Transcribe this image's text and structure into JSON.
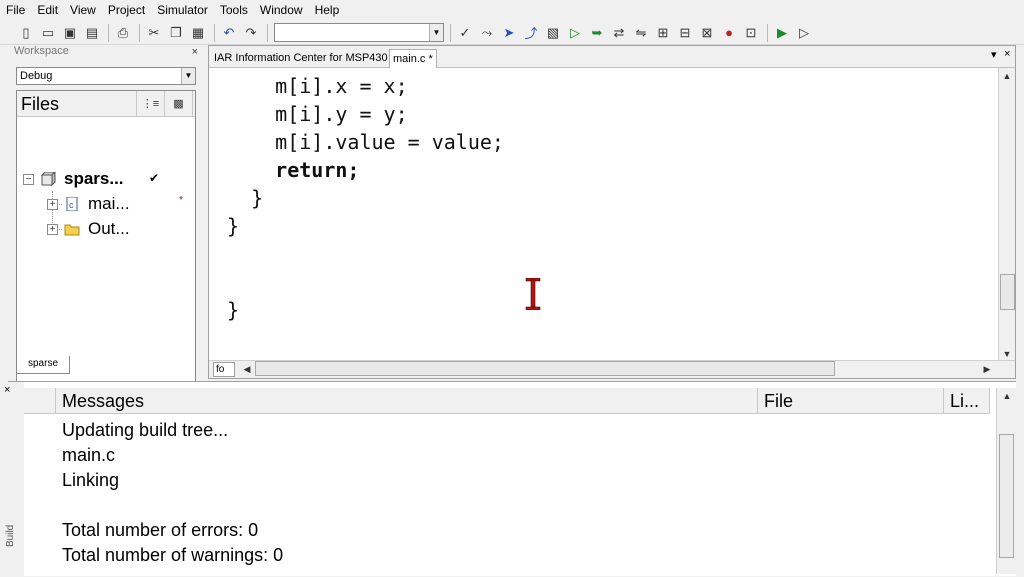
{
  "menu": [
    "File",
    "Edit",
    "View",
    "Project",
    "Simulator",
    "Tools",
    "Window",
    "Help"
  ],
  "toolbar": {
    "icons": [
      "new-file-icon",
      "open-icon",
      "save-icon",
      "save-all-icon",
      "print-icon",
      "cut-icon",
      "copy-icon",
      "paste-icon",
      "undo-icon",
      "redo-icon"
    ],
    "find_value": ""
  },
  "workspace": {
    "title": "Workspace",
    "close": "×",
    "config": "Debug",
    "files_header": "Files",
    "tree": [
      {
        "label": "spars...",
        "mark": "✔",
        "type": "project"
      },
      {
        "label": "mai...",
        "mark": "*",
        "type": "c-file"
      },
      {
        "label": "Out...",
        "mark": "",
        "type": "folder"
      }
    ],
    "tab": "sparse"
  },
  "editor": {
    "tabs": [
      {
        "label": "IAR Information Center for MSP430",
        "active": false
      },
      {
        "label": "main.c *",
        "active": true
      }
    ],
    "lines": [
      {
        "text": "    m[i].x = x;",
        "bold": false
      },
      {
        "text": "    m[i].y = y;",
        "bold": false
      },
      {
        "text": "    m[i].value = value;",
        "bold": false
      },
      {
        "text": "    return;",
        "bold": true
      },
      {
        "text": "  }",
        "bold": false
      },
      {
        "text": "}",
        "bold": false
      },
      {
        "text": "",
        "bold": false
      },
      {
        "text": "",
        "bold": false
      },
      {
        "text": "}",
        "bold": false
      }
    ],
    "function_box": "fo"
  },
  "build": {
    "side_label": "Build",
    "close": "×",
    "columns": [
      "Messages",
      "File",
      "Li..."
    ],
    "messages": [
      "Updating build tree...",
      "main.c",
      "Linking",
      "",
      "Total number of errors: 0",
      "Total number of warnings: 0"
    ]
  }
}
